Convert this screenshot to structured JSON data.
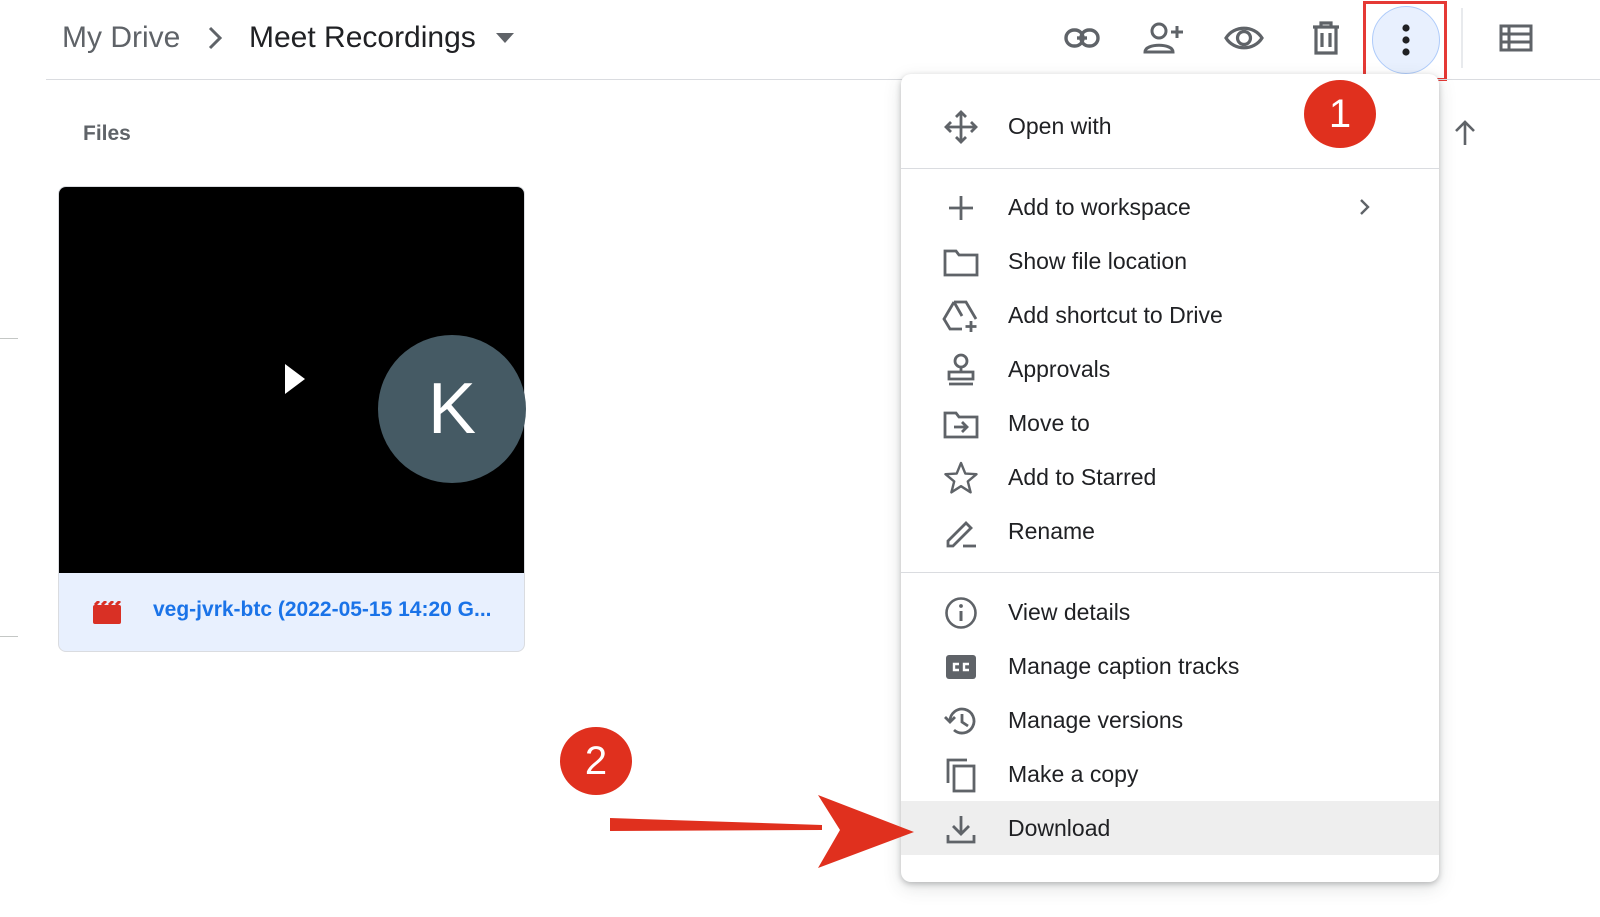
{
  "breadcrumb": {
    "root": "My Drive",
    "current": "Meet Recordings"
  },
  "toolbar": {
    "icons": [
      "link-icon",
      "add-person-icon",
      "eye-icon",
      "trash-icon",
      "more-vert-icon",
      "list-view-icon"
    ]
  },
  "files": {
    "heading": "Files",
    "card": {
      "name": "veg-jvrk-btc (2022-05-15 14:20 G...",
      "avatar_initial": "K",
      "type_icon": "video-file-icon"
    }
  },
  "menu": {
    "items": [
      {
        "label": "Open with",
        "icon": "open-with-icon"
      },
      {
        "label": "Add to workspace",
        "icon": "plus-icon",
        "submenu": true
      },
      {
        "label": "Show file location",
        "icon": "folder-icon"
      },
      {
        "label": "Add shortcut to Drive",
        "icon": "drive-shortcut-icon"
      },
      {
        "label": "Approvals",
        "icon": "stamp-icon"
      },
      {
        "label": "Move to",
        "icon": "move-to-folder-icon"
      },
      {
        "label": "Add to Starred",
        "icon": "star-icon"
      },
      {
        "label": "Rename",
        "icon": "pencil-icon"
      },
      {
        "label": "View details",
        "icon": "info-icon"
      },
      {
        "label": "Manage caption tracks",
        "icon": "cc-icon"
      },
      {
        "label": "Manage versions",
        "icon": "history-icon"
      },
      {
        "label": "Make a copy",
        "icon": "copy-icon"
      },
      {
        "label": "Download",
        "icon": "download-icon",
        "highlighted": true
      }
    ]
  },
  "annotations": {
    "step1": "1",
    "step2": "2",
    "highlight_color": "#e53935",
    "badge_color": "#e0301e"
  },
  "colors": {
    "link": "#1a73e8",
    "selected_button": "#e8f0fe",
    "hover_row": "#eeeeee"
  }
}
